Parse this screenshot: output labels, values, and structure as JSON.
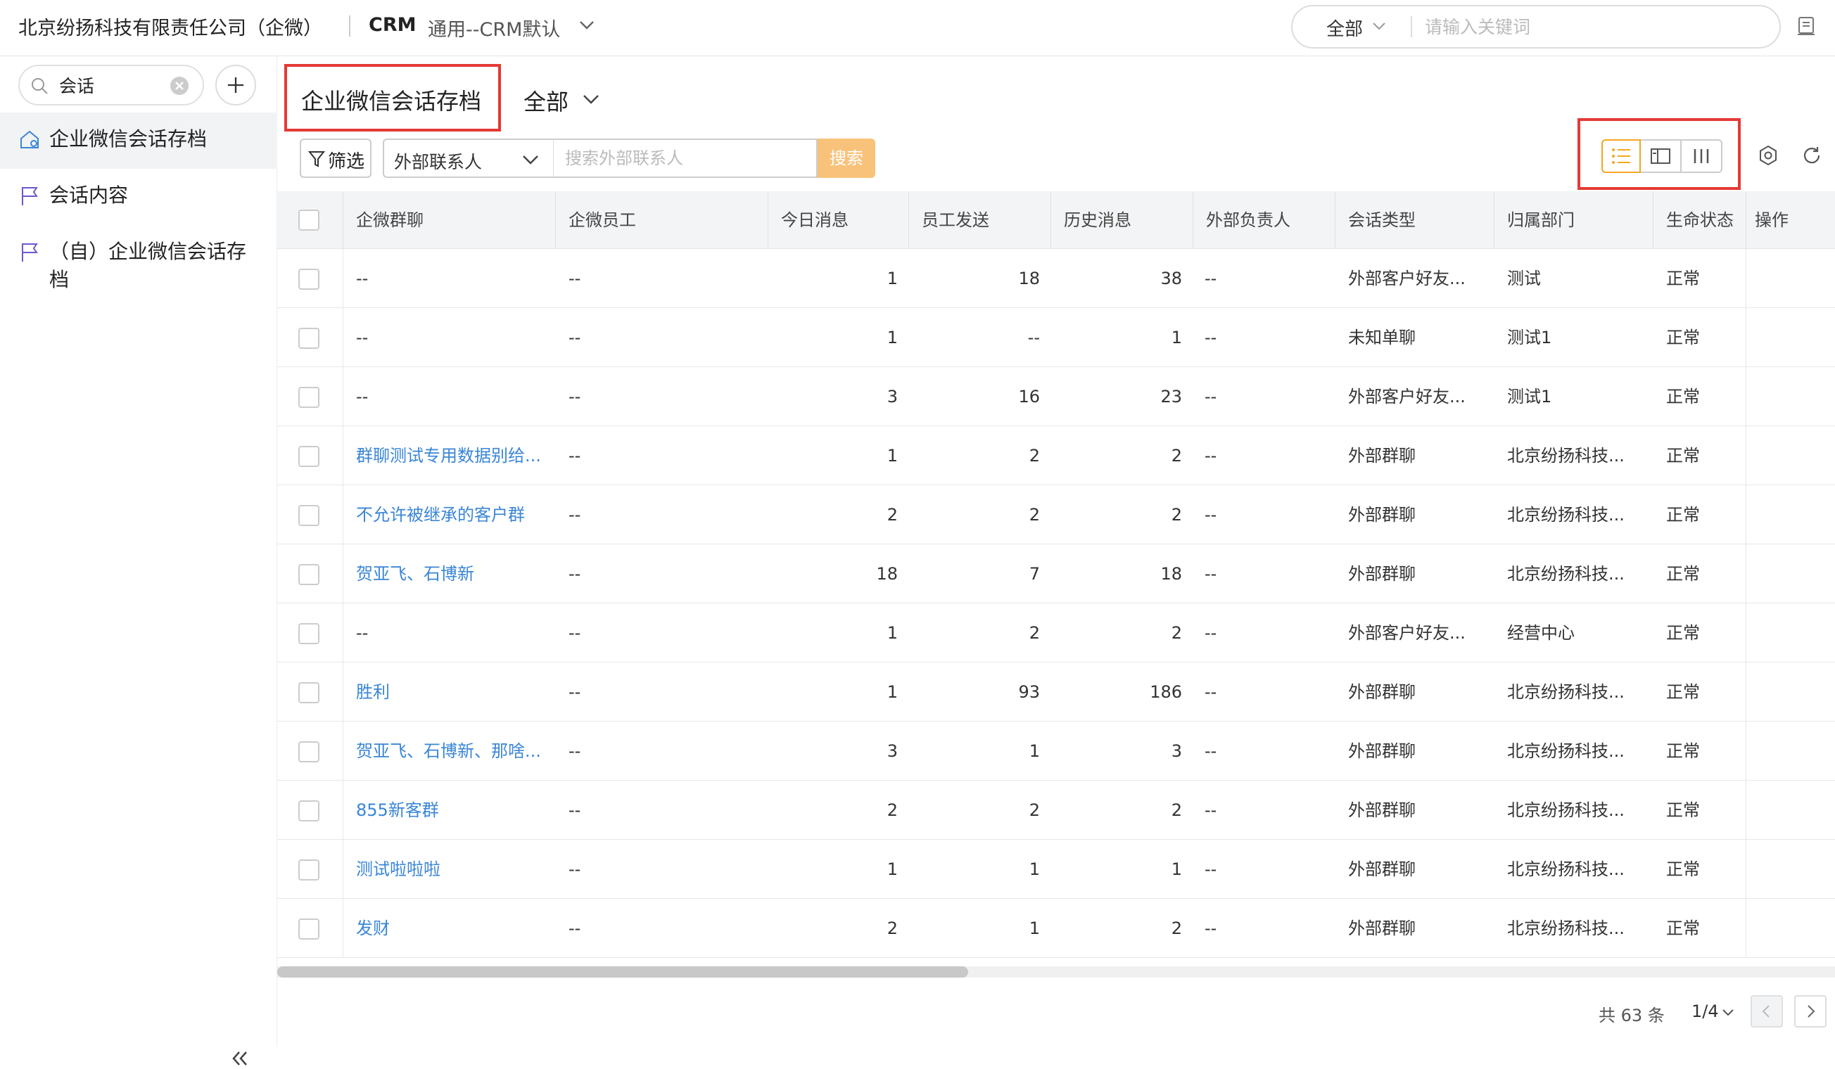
{
  "topbar": {
    "company": "北京纷扬科技有限责任公司（企微）",
    "app": "CRM",
    "app_sub": "通用--CRM默认",
    "search_scope": "全部",
    "search_placeholder": "请输入关键词"
  },
  "sidebar": {
    "search_value": "会话",
    "items": [
      {
        "label": "企业微信会话存档",
        "icon": "home-icon"
      },
      {
        "label": "会话内容",
        "icon": "flag-icon"
      },
      {
        "label": "（自）企业微信会话存档",
        "icon": "flag-icon"
      }
    ]
  },
  "view": {
    "title": "企业微信会话存档",
    "scope": "全部",
    "filter_label": "筛选",
    "field_select": "外部联系人",
    "keyword_placeholder": "搜索外部联系人",
    "search_button": "搜索"
  },
  "table": {
    "columns": [
      "企微群聊",
      "企微员工",
      "今日消息",
      "员工发送",
      "历史消息",
      "外部负责人",
      "会话类型",
      "归属部门",
      "生命状态",
      "操作"
    ],
    "rows": [
      {
        "group": "--",
        "staff": "--",
        "today": "1",
        "sent": "18",
        "history": "38",
        "owner": "--",
        "type": "外部客户好友...",
        "dept": "测试",
        "status": "正常",
        "link": false
      },
      {
        "group": "--",
        "staff": "--",
        "today": "1",
        "sent": "--",
        "history": "1",
        "owner": "--",
        "type": "未知单聊",
        "dept": "测试1",
        "status": "正常",
        "link": false
      },
      {
        "group": "--",
        "staff": "--",
        "today": "3",
        "sent": "16",
        "history": "23",
        "owner": "--",
        "type": "外部客户好友...",
        "dept": "测试1",
        "status": "正常",
        "link": false
      },
      {
        "group": "群聊测试专用数据别给...",
        "staff": "--",
        "today": "1",
        "sent": "2",
        "history": "2",
        "owner": "--",
        "type": "外部群聊",
        "dept": "北京纷扬科技...",
        "status": "正常",
        "link": true
      },
      {
        "group": "不允许被继承的客户群",
        "staff": "--",
        "today": "2",
        "sent": "2",
        "history": "2",
        "owner": "--",
        "type": "外部群聊",
        "dept": "北京纷扬科技...",
        "status": "正常",
        "link": true
      },
      {
        "group": "贺亚飞、石博新",
        "staff": "--",
        "today": "18",
        "sent": "7",
        "history": "18",
        "owner": "--",
        "type": "外部群聊",
        "dept": "北京纷扬科技...",
        "status": "正常",
        "link": true
      },
      {
        "group": "--",
        "staff": "--",
        "today": "1",
        "sent": "2",
        "history": "2",
        "owner": "--",
        "type": "外部客户好友...",
        "dept": "经营中心",
        "status": "正常",
        "link": false
      },
      {
        "group": "胜利",
        "staff": "--",
        "today": "1",
        "sent": "93",
        "history": "186",
        "owner": "--",
        "type": "外部群聊",
        "dept": "北京纷扬科技...",
        "status": "正常",
        "link": true
      },
      {
        "group": "贺亚飞、石博新、那啥...",
        "staff": "--",
        "today": "3",
        "sent": "1",
        "history": "3",
        "owner": "--",
        "type": "外部群聊",
        "dept": "北京纷扬科技...",
        "status": "正常",
        "link": true
      },
      {
        "group": "855新客群",
        "staff": "--",
        "today": "2",
        "sent": "2",
        "history": "2",
        "owner": "--",
        "type": "外部群聊",
        "dept": "北京纷扬科技...",
        "status": "正常",
        "link": true
      },
      {
        "group": "测试啦啦啦",
        "staff": "--",
        "today": "1",
        "sent": "1",
        "history": "1",
        "owner": "--",
        "type": "外部群聊",
        "dept": "北京纷扬科技...",
        "status": "正常",
        "link": true
      },
      {
        "group": "发财",
        "staff": "--",
        "today": "2",
        "sent": "1",
        "history": "2",
        "owner": "--",
        "type": "外部群聊",
        "dept": "北京纷扬科技...",
        "status": "正常",
        "link": true
      }
    ]
  },
  "pagination": {
    "total": "共 63 条",
    "page": "1/4"
  },
  "colors": {
    "accent": "#f5a623",
    "link": "#3a86d6",
    "highlight": "#e53935"
  }
}
